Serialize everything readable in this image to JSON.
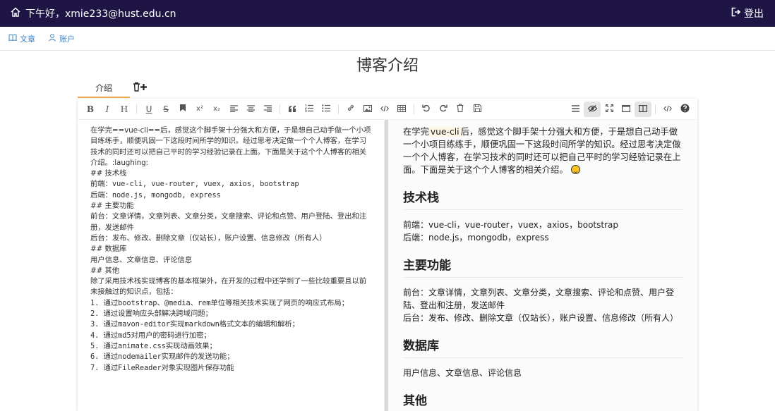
{
  "topbar": {
    "greeting": "下午好，xmie233@hust.edu.cn",
    "logout_label": "登出"
  },
  "subnav": {
    "articles_label": "文章",
    "account_label": "账户"
  },
  "page": {
    "title": "博客介绍"
  },
  "tabs": {
    "active_label": "介绍"
  },
  "toolbar": {
    "bold": "B",
    "italic": "I",
    "header": "H",
    "underline": "U",
    "strike": "S",
    "superscript": "x²",
    "subscript": "x₂"
  },
  "source": {
    "lines": [
      {
        "text": "在学完==vue-cli==后，感觉这个脚手架十分强大和方便，于是想自己动手做一个小项",
        "cjk": true
      },
      {
        "text": "目练练手，顺便巩固一下这段时间所学的知识。经过思考决定做一个个人博客，在学习",
        "cjk": true
      },
      {
        "text": "技术的同时还可以把自己平时的学习经验记录在上面。下面是关于这个个人博客的相关",
        "cjk": true
      },
      {
        "text": "介绍。:laughing:",
        "cjk": true
      },
      {
        "text": "## 技术栈",
        "cjk": true
      },
      {
        "text": "前端：vue-cli, vue-router, vuex, axios, bootstrap",
        "cjk": false
      },
      {
        "text": "后端：node.js, mongodb, express",
        "cjk": false
      },
      {
        "text": "## 主要功能",
        "cjk": true
      },
      {
        "text": "前台：文章详情，文章列表、文章分类，文章搜索、评论和点赞、用户登陆、登出和注",
        "cjk": true
      },
      {
        "text": "册，发送邮件",
        "cjk": true
      },
      {
        "text": "后台：发布、修改、删除文章（仅站长），账户设置、信息修改（所有人）",
        "cjk": true
      },
      {
        "text": "## 数据库",
        "cjk": true
      },
      {
        "text": "用户信息、文章信息、评论信息",
        "cjk": true
      },
      {
        "text": "## 其他",
        "cjk": true
      },
      {
        "text": "除了采用技术栈实现博客的基本框架外，在开发的过程中还学到了一些比较重要且以前",
        "cjk": true
      },
      {
        "text": "未接触过的知识点，包括：",
        "cjk": true
      },
      {
        "text": "1. 通过bootstrap、@media、rem单位等相关技术实现了网页的响应式布局；",
        "cjk": false
      },
      {
        "text": "2. 通过设置响应头部解决跨域问题；",
        "cjk": false
      },
      {
        "text": "3. 通过mavon-editor实现markdown格式文本的编辑和解析；",
        "cjk": false
      },
      {
        "text": "4. 通过md5对用户的密码进行加密；",
        "cjk": false
      },
      {
        "text": "5. 通过animate.css实现动画效果；",
        "cjk": false
      },
      {
        "text": "6. 通过nodemailer实现邮件的发送功能；",
        "cjk": false
      },
      {
        "text": "7. 通过FileReader对象实现图片保存功能",
        "cjk": false
      }
    ]
  },
  "preview": {
    "intro_prefix": "在学完",
    "intro_mark": "vue-cli",
    "intro_rest": "后，感觉这个脚手架十分强大和方便，于是想自己动手做一个小项目练练手，顺便巩固一下这段时间所学的知识。经过思考决定做一个个人博客，在学习技术的同时还可以把自己平时的学习经验记录在上面。下面是关于这个个人博客的相关介绍。",
    "h_tech": "技术栈",
    "tech_front": "前端：vue-cli，vue-router，vuex，axios，bootstrap",
    "tech_back": "后端：node.js，mongodb，express",
    "h_features": "主要功能",
    "feat_front": "前台：文章详情，文章列表、文章分类，文章搜索、评论和点赞、用户登陆、登出和注册，发送邮件",
    "feat_back": "后台：发布、修改、删除文章（仅站长），账户设置、信息修改（所有人）",
    "h_db": "数据库",
    "db_text": "用户信息、文章信息、评论信息",
    "h_other": "其他"
  }
}
